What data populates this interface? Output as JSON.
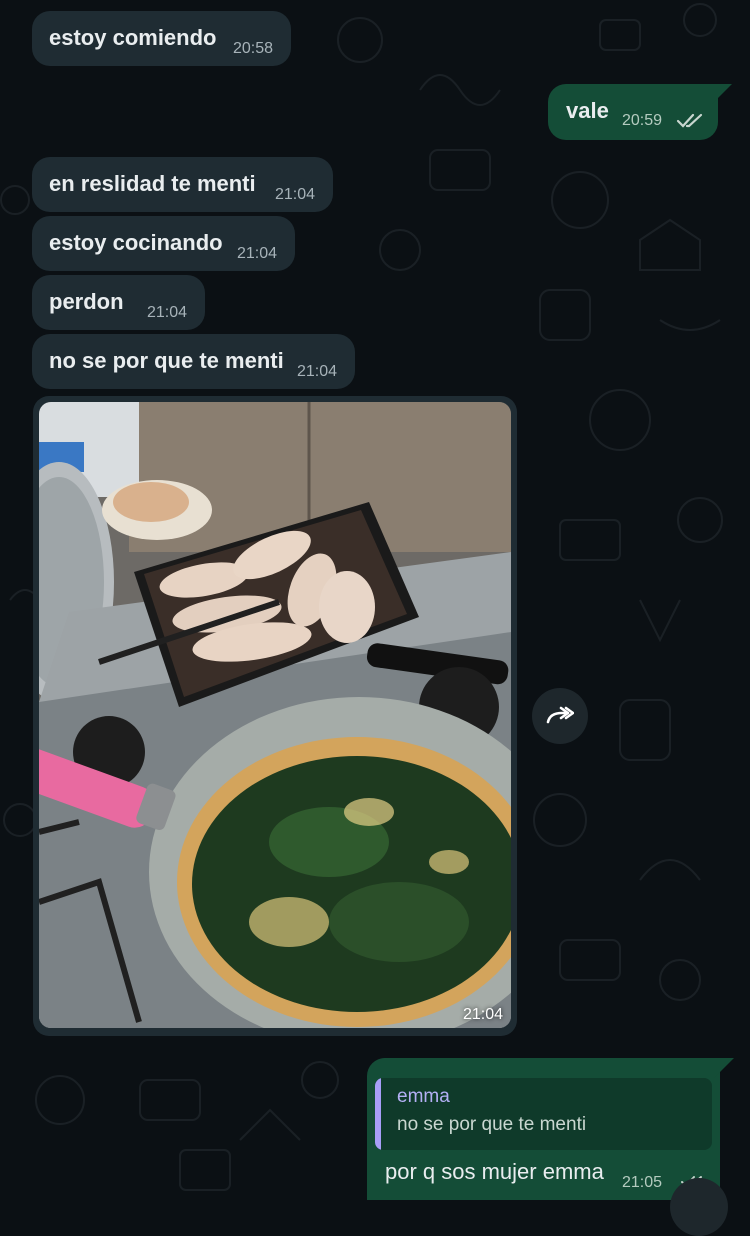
{
  "messages": [
    {
      "text": "estoy comiendo",
      "time": "20:58"
    },
    {
      "text": "vale",
      "time": "20:59"
    },
    {
      "text": "en reslidad te menti",
      "time": "21:04"
    },
    {
      "text": "estoy cocinando",
      "time": "21:04"
    },
    {
      "text": "perdon",
      "time": "21:04"
    },
    {
      "text": "no se por que te menti",
      "time": "21:04"
    }
  ],
  "photo_message": {
    "time": "21:04"
  },
  "reply_message": {
    "quoted_author": "emma",
    "quoted_text": "no se por que te menti",
    "text": "por q sos mujer emma",
    "time": "21:05"
  },
  "icons": {
    "read_receipt": "double-check-icon",
    "forward": "forward-icon"
  },
  "colors": {
    "incoming_bubble": "#1f2c33",
    "outgoing_bubble": "#144d37",
    "background": "#0b1014"
  }
}
